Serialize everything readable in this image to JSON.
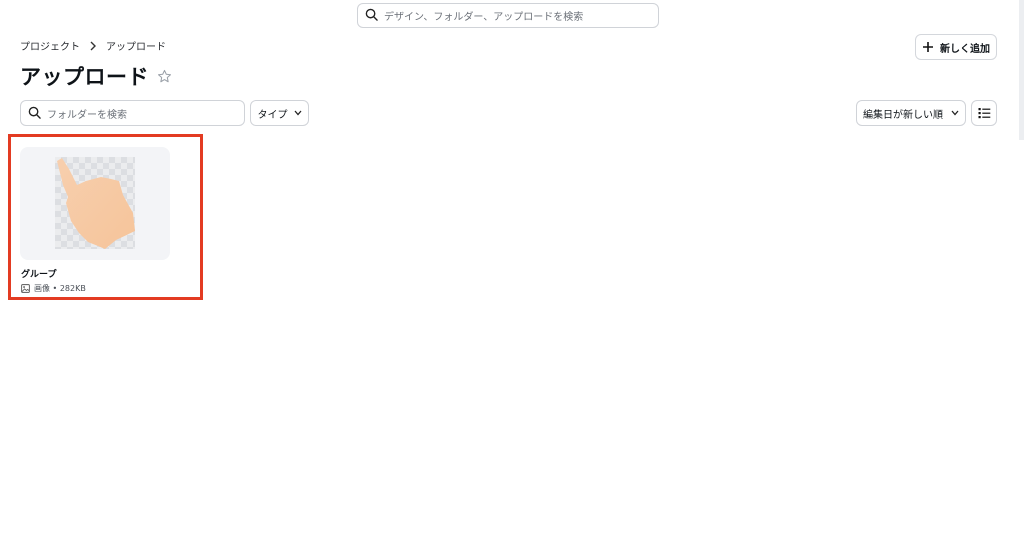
{
  "search": {
    "placeholder": "デザイン、フォルダー、アップロードを検索"
  },
  "breadcrumb": {
    "root": "プロジェクト",
    "current": "アップロード"
  },
  "header": {
    "title": "アップロード",
    "new_button": "新しく追加"
  },
  "toolbar": {
    "folder_search_placeholder": "フォルダーを検索",
    "type_filter": "タイプ",
    "sort": "編集日が新しい順"
  },
  "files": [
    {
      "name": "グループ",
      "type": "画像",
      "size": "282KB"
    }
  ],
  "colors": {
    "highlight": "#e33b22",
    "thumbnail_fill": "#f8d1ae"
  },
  "icons": [
    "search-icon",
    "chevron-right-icon",
    "plus-icon",
    "star-outline-icon",
    "chevron-down-icon",
    "list-view-icon",
    "image-icon"
  ]
}
